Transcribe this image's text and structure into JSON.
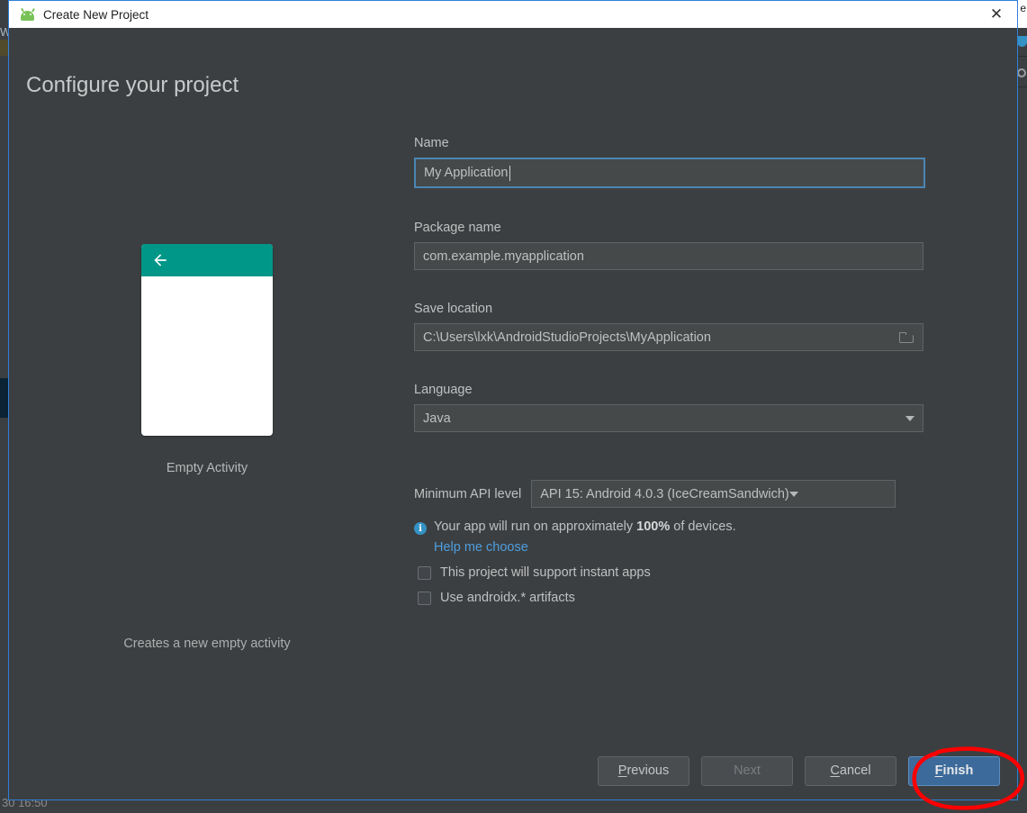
{
  "window": {
    "title": "Create New Project",
    "app_icon": "android-robot-icon",
    "close_label": "✕"
  },
  "page": {
    "heading": "Configure your project"
  },
  "preview": {
    "template_name": "Empty Activity",
    "description": "Creates a new empty activity",
    "accent_color": "#009688",
    "back_icon": "back-arrow-icon"
  },
  "form": {
    "name": {
      "label": "Name",
      "value": "My Application",
      "focused": true
    },
    "package_name": {
      "label": "Package name",
      "value": "com.example.myapplication"
    },
    "save_location": {
      "label": "Save location",
      "value": "C:\\Users\\lxk\\AndroidStudioProjects\\MyApplication",
      "browse_icon": "folder-icon"
    },
    "language": {
      "label": "Language",
      "value": "Java",
      "dropdown_icon": "chevron-down-icon"
    },
    "min_api": {
      "label": "Minimum API level",
      "value": "API 15: Android 4.0.3 (IceCreamSandwich)",
      "dropdown_icon": "chevron-down-icon"
    },
    "device_info": {
      "icon": "info-icon",
      "icon_glyph": "i",
      "prefix": "Your app will run on approximately ",
      "percent": "100%",
      "suffix": " of devices.",
      "link": "Help me choose",
      "link_color": "#4d9ee0"
    },
    "checkboxes": [
      {
        "label": "This project will support instant apps",
        "checked": false
      },
      {
        "label": "Use androidx.* artifacts",
        "checked": false
      }
    ]
  },
  "footer": {
    "buttons": [
      {
        "label": "Previous",
        "mnemonic": "P",
        "state": "enabled"
      },
      {
        "label": "Next",
        "mnemonic": "",
        "state": "disabled"
      },
      {
        "label": "Cancel",
        "mnemonic": "C",
        "state": "enabled"
      },
      {
        "label": "Finish",
        "mnemonic": "F",
        "state": "default"
      }
    ]
  },
  "annotation": {
    "shape": "hand-drawn-ellipse",
    "color": "#ff0000",
    "targets": "Finish"
  },
  "backdrop": {
    "left_fragment": "W",
    "bottom_fragment": "30 16:50",
    "right_fragment": "e"
  },
  "colors": {
    "dialog_bg": "#3c3f41",
    "dialog_border": "#2f80d8",
    "input_bg": "#45494a",
    "focus_border": "#4b86b4",
    "primary_button": "#3c6a9a",
    "teal": "#009688"
  }
}
